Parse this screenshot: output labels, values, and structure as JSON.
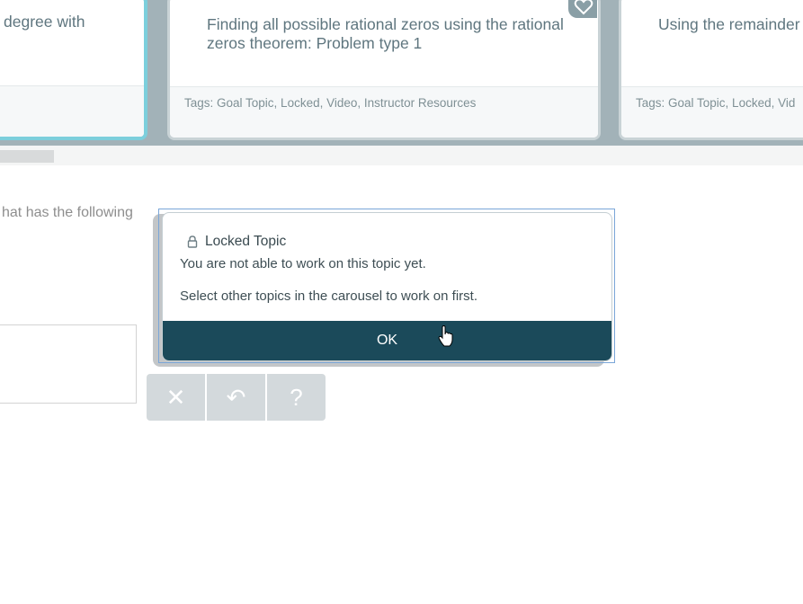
{
  "carousel": {
    "cards": [
      {
        "title": "degree with",
        "tags": ""
      },
      {
        "title": "Finding all possible rational zeros using the rational zeros theorem: Problem type 1",
        "tags": "Tags: Goal Topic, Locked, Video, Instructor Resources"
      },
      {
        "title": "Using the remainder polynomial",
        "tags": "Tags: Goal Topic, Locked, Vid"
      }
    ]
  },
  "question": {
    "text": "hat has the following"
  },
  "toolbar": {
    "clear_label": "✕",
    "undo_label": "↶",
    "help_label": "?"
  },
  "modal": {
    "title": "Locked Topic",
    "message1": "You are not able to work on this topic yet.",
    "message2": "Select other topics in the carousel to work on first.",
    "ok_label": "OK"
  },
  "colors": {
    "accent": "#7ccfdc",
    "button": "#1b4a5a",
    "carousel_bg": "#a2b2b8"
  }
}
